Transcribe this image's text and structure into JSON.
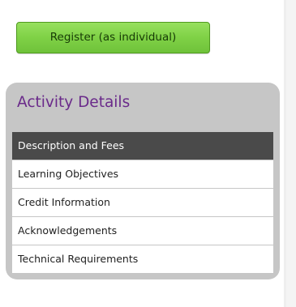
{
  "register_button": {
    "label": "Register (as individual)"
  },
  "activity_panel": {
    "title": "Activity Details",
    "items": [
      {
        "label": "Description and Fees",
        "active": true
      },
      {
        "label": "Learning Objectives",
        "active": false
      },
      {
        "label": "Credit Information",
        "active": false
      },
      {
        "label": "Acknowledgements",
        "active": false
      },
      {
        "label": "Technical Requirements",
        "active": false
      }
    ]
  },
  "colors": {
    "register_green": "#7fd146",
    "title_purple": "#6a2a8a",
    "active_item_bg": "#4a4a4a",
    "panel_bg": "#c6c6c6"
  }
}
